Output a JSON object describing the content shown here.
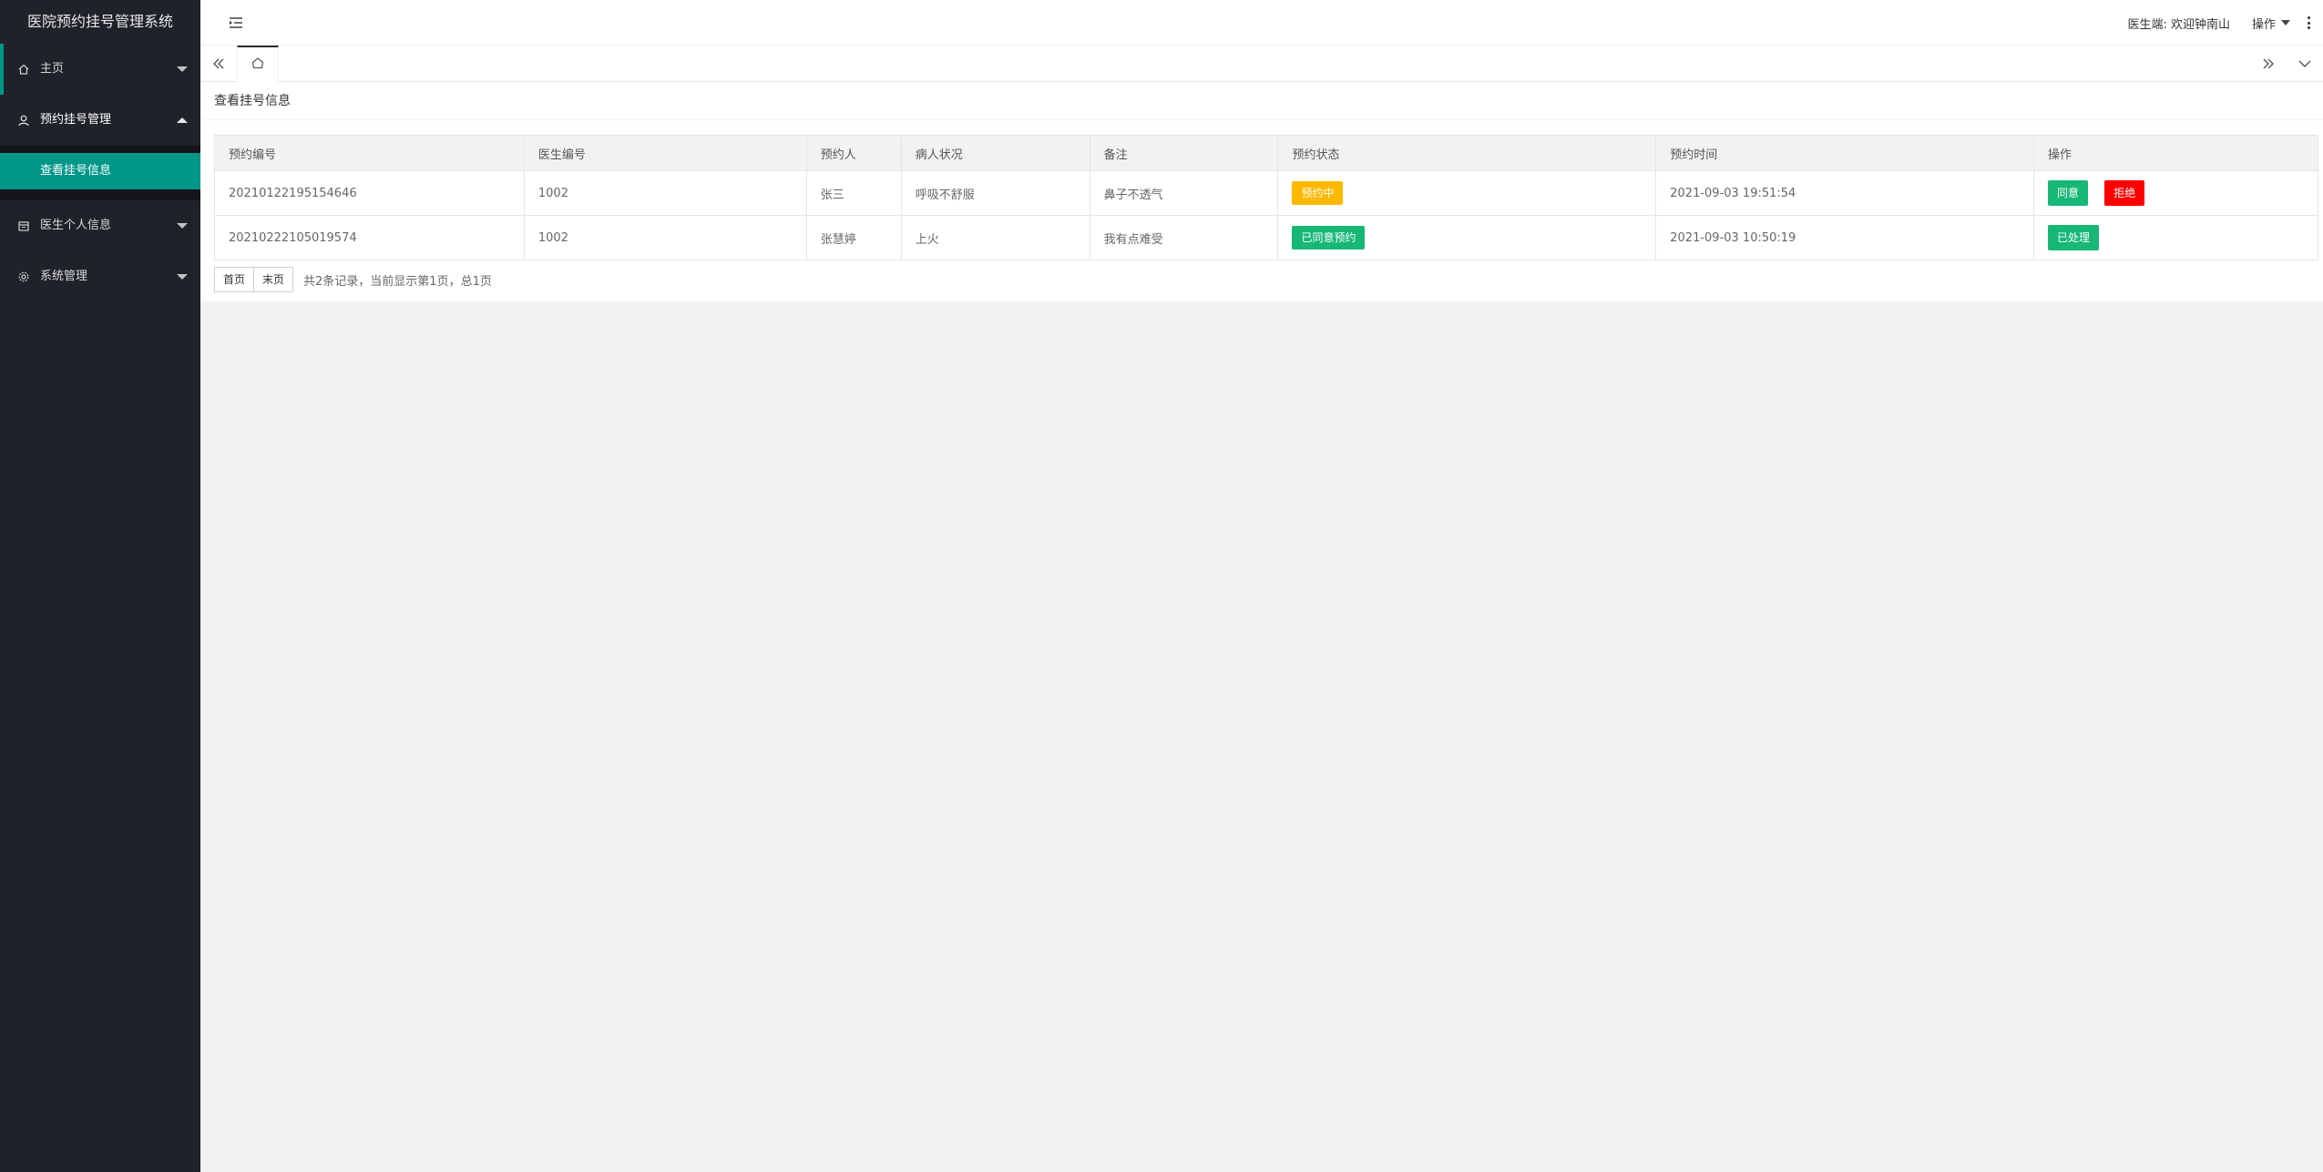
{
  "app": {
    "title": "医院预约挂号管理系统"
  },
  "sidebar": {
    "items": [
      {
        "label": "主页",
        "icon": "home-icon"
      },
      {
        "label": "预约挂号管理",
        "icon": "user-icon",
        "children": [
          {
            "label": "查看挂号信息"
          }
        ]
      },
      {
        "label": "医生个人信息",
        "icon": "calendar-icon"
      },
      {
        "label": "系统管理",
        "icon": "gear-icon"
      }
    ]
  },
  "header": {
    "welcome": "医生端: 欢迎钟南山",
    "ops_label": "操作"
  },
  "page": {
    "title": "查看挂号信息"
  },
  "table": {
    "columns": [
      "预约编号",
      "医生编号",
      "预约人",
      "病人状况",
      "备注",
      "预约状态",
      "预约时间",
      "操作"
    ],
    "rows": [
      {
        "id": "20210122195154646",
        "doctor_id": "1002",
        "patient": "张三",
        "condition": "呼吸不舒服",
        "remark": "鼻子不透气",
        "status": "预约中",
        "time": "2021-09-03 19:51:54",
        "actions": [
          "同意",
          "拒绝"
        ]
      },
      {
        "id": "20210222105019574",
        "doctor_id": "1002",
        "patient": "张慧婷",
        "condition": "上火",
        "remark": "我有点难受",
        "status": "已同意预约",
        "time": "2021-09-03 10:50:19",
        "actions": [
          "已处理"
        ]
      }
    ]
  },
  "pager": {
    "first": "首页",
    "last": "末页",
    "info": "共2条记录，当前显示第1页，总1页"
  },
  "colors": {
    "sidebar_bg": "#20222a",
    "accent": "#009688",
    "pending": "#ffb800",
    "success": "#16b777",
    "danger": "#ff0000"
  }
}
